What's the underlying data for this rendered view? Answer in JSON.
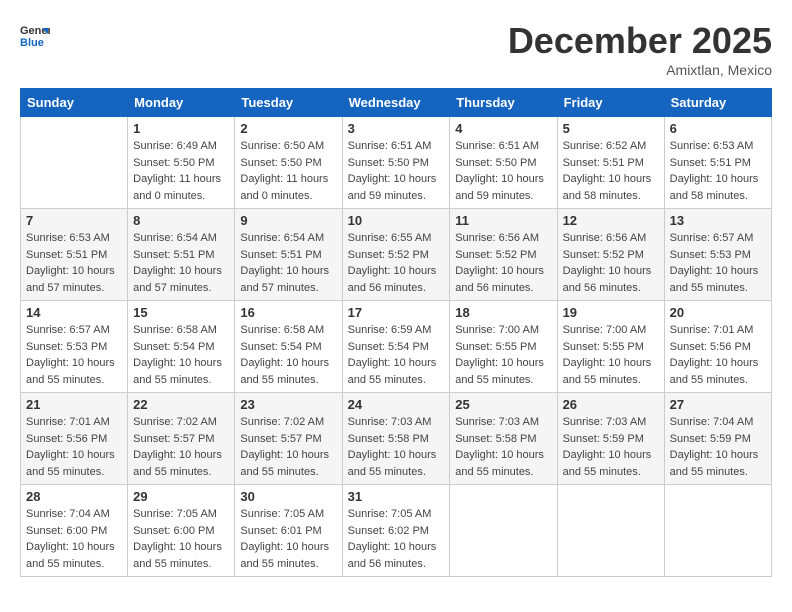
{
  "header": {
    "logo_general": "General",
    "logo_blue": "Blue",
    "month_title": "December 2025",
    "subtitle": "Amixtlan, Mexico"
  },
  "weekdays": [
    "Sunday",
    "Monday",
    "Tuesday",
    "Wednesday",
    "Thursday",
    "Friday",
    "Saturday"
  ],
  "weeks": [
    [
      {
        "day": "",
        "info": ""
      },
      {
        "day": "1",
        "info": "Sunrise: 6:49 AM\nSunset: 5:50 PM\nDaylight: 11 hours\nand 0 minutes."
      },
      {
        "day": "2",
        "info": "Sunrise: 6:50 AM\nSunset: 5:50 PM\nDaylight: 11 hours\nand 0 minutes."
      },
      {
        "day": "3",
        "info": "Sunrise: 6:51 AM\nSunset: 5:50 PM\nDaylight: 10 hours\nand 59 minutes."
      },
      {
        "day": "4",
        "info": "Sunrise: 6:51 AM\nSunset: 5:50 PM\nDaylight: 10 hours\nand 59 minutes."
      },
      {
        "day": "5",
        "info": "Sunrise: 6:52 AM\nSunset: 5:51 PM\nDaylight: 10 hours\nand 58 minutes."
      },
      {
        "day": "6",
        "info": "Sunrise: 6:53 AM\nSunset: 5:51 PM\nDaylight: 10 hours\nand 58 minutes."
      }
    ],
    [
      {
        "day": "7",
        "info": "Sunrise: 6:53 AM\nSunset: 5:51 PM\nDaylight: 10 hours\nand 57 minutes."
      },
      {
        "day": "8",
        "info": "Sunrise: 6:54 AM\nSunset: 5:51 PM\nDaylight: 10 hours\nand 57 minutes."
      },
      {
        "day": "9",
        "info": "Sunrise: 6:54 AM\nSunset: 5:51 PM\nDaylight: 10 hours\nand 57 minutes."
      },
      {
        "day": "10",
        "info": "Sunrise: 6:55 AM\nSunset: 5:52 PM\nDaylight: 10 hours\nand 56 minutes."
      },
      {
        "day": "11",
        "info": "Sunrise: 6:56 AM\nSunset: 5:52 PM\nDaylight: 10 hours\nand 56 minutes."
      },
      {
        "day": "12",
        "info": "Sunrise: 6:56 AM\nSunset: 5:52 PM\nDaylight: 10 hours\nand 56 minutes."
      },
      {
        "day": "13",
        "info": "Sunrise: 6:57 AM\nSunset: 5:53 PM\nDaylight: 10 hours\nand 55 minutes."
      }
    ],
    [
      {
        "day": "14",
        "info": "Sunrise: 6:57 AM\nSunset: 5:53 PM\nDaylight: 10 hours\nand 55 minutes."
      },
      {
        "day": "15",
        "info": "Sunrise: 6:58 AM\nSunset: 5:54 PM\nDaylight: 10 hours\nand 55 minutes."
      },
      {
        "day": "16",
        "info": "Sunrise: 6:58 AM\nSunset: 5:54 PM\nDaylight: 10 hours\nand 55 minutes."
      },
      {
        "day": "17",
        "info": "Sunrise: 6:59 AM\nSunset: 5:54 PM\nDaylight: 10 hours\nand 55 minutes."
      },
      {
        "day": "18",
        "info": "Sunrise: 7:00 AM\nSunset: 5:55 PM\nDaylight: 10 hours\nand 55 minutes."
      },
      {
        "day": "19",
        "info": "Sunrise: 7:00 AM\nSunset: 5:55 PM\nDaylight: 10 hours\nand 55 minutes."
      },
      {
        "day": "20",
        "info": "Sunrise: 7:01 AM\nSunset: 5:56 PM\nDaylight: 10 hours\nand 55 minutes."
      }
    ],
    [
      {
        "day": "21",
        "info": "Sunrise: 7:01 AM\nSunset: 5:56 PM\nDaylight: 10 hours\nand 55 minutes."
      },
      {
        "day": "22",
        "info": "Sunrise: 7:02 AM\nSunset: 5:57 PM\nDaylight: 10 hours\nand 55 minutes."
      },
      {
        "day": "23",
        "info": "Sunrise: 7:02 AM\nSunset: 5:57 PM\nDaylight: 10 hours\nand 55 minutes."
      },
      {
        "day": "24",
        "info": "Sunrise: 7:03 AM\nSunset: 5:58 PM\nDaylight: 10 hours\nand 55 minutes."
      },
      {
        "day": "25",
        "info": "Sunrise: 7:03 AM\nSunset: 5:58 PM\nDaylight: 10 hours\nand 55 minutes."
      },
      {
        "day": "26",
        "info": "Sunrise: 7:03 AM\nSunset: 5:59 PM\nDaylight: 10 hours\nand 55 minutes."
      },
      {
        "day": "27",
        "info": "Sunrise: 7:04 AM\nSunset: 5:59 PM\nDaylight: 10 hours\nand 55 minutes."
      }
    ],
    [
      {
        "day": "28",
        "info": "Sunrise: 7:04 AM\nSunset: 6:00 PM\nDaylight: 10 hours\nand 55 minutes."
      },
      {
        "day": "29",
        "info": "Sunrise: 7:05 AM\nSunset: 6:00 PM\nDaylight: 10 hours\nand 55 minutes."
      },
      {
        "day": "30",
        "info": "Sunrise: 7:05 AM\nSunset: 6:01 PM\nDaylight: 10 hours\nand 55 minutes."
      },
      {
        "day": "31",
        "info": "Sunrise: 7:05 AM\nSunset: 6:02 PM\nDaylight: 10 hours\nand 56 minutes."
      },
      {
        "day": "",
        "info": ""
      },
      {
        "day": "",
        "info": ""
      },
      {
        "day": "",
        "info": ""
      }
    ]
  ]
}
